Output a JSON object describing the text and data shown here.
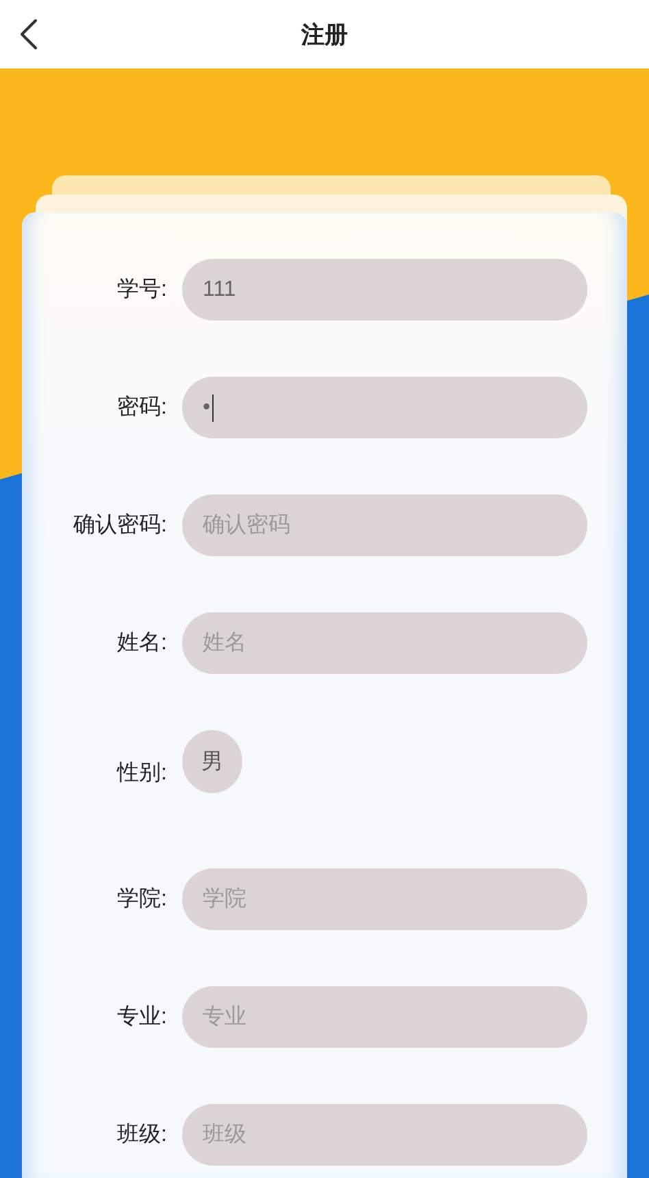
{
  "header": {
    "title": "注册"
  },
  "fields": [
    {
      "label": "学号:",
      "kind": "input",
      "value": "111",
      "focused": false
    },
    {
      "label": "密码:",
      "kind": "input",
      "value": "•",
      "focused": true
    },
    {
      "label": "确认密码:",
      "kind": "input",
      "placeholder": "确认密码",
      "focused": false
    },
    {
      "label": "姓名:",
      "kind": "input",
      "placeholder": "姓名",
      "focused": false
    },
    {
      "label": "性别:",
      "kind": "choice",
      "value": "男"
    },
    {
      "label": "学院:",
      "kind": "input",
      "placeholder": "学院",
      "focused": false
    },
    {
      "label": "专业:",
      "kind": "input",
      "placeholder": "专业",
      "focused": false
    },
    {
      "label": "班级:",
      "kind": "input",
      "placeholder": "班级",
      "focused": false
    }
  ]
}
